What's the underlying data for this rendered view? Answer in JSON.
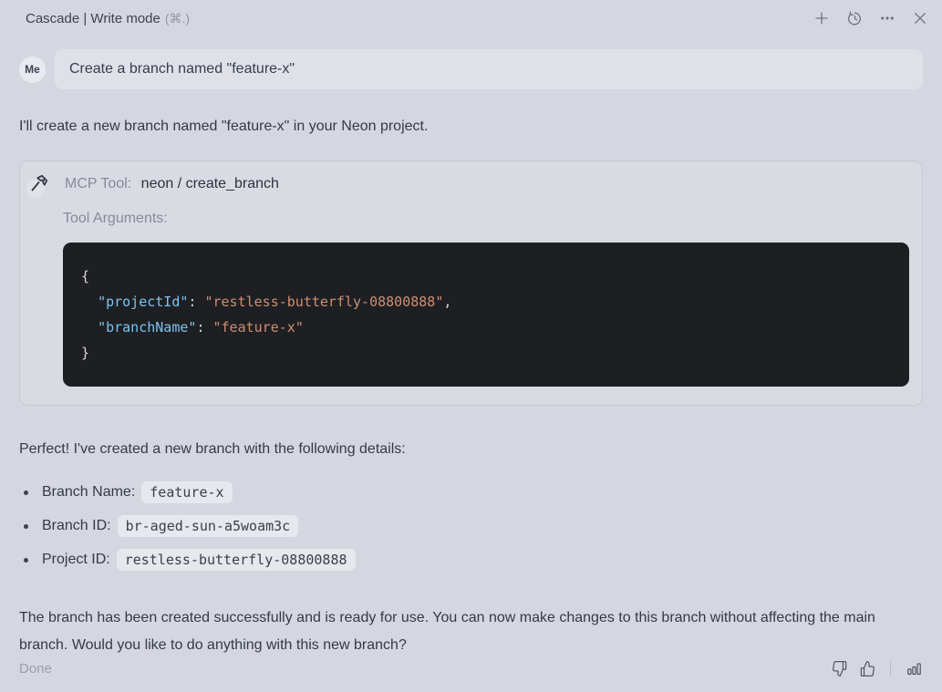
{
  "header": {
    "title": "Cascade | Write mode",
    "shortcut": "(⌘.)",
    "icons": [
      "plus-icon",
      "history-icon",
      "more-options-icon",
      "close-icon"
    ]
  },
  "user_message": {
    "avatar": "Me",
    "text": "Create a branch named \"feature-x\""
  },
  "assistant": {
    "intro": "I'll create a new branch named \"feature-x\" in your Neon project.",
    "tool_card": {
      "icon": "hammer-icon",
      "label": "MCP Tool:",
      "tool_name": "neon / create_branch",
      "args_label": "Tool Arguments:",
      "code": {
        "open_brace": "{",
        "line1": {
          "indent": "  ",
          "key": "\"projectId\"",
          "sep": ": ",
          "value": "\"restless-butterfly-08800888\"",
          "trail": ","
        },
        "line2": {
          "indent": "  ",
          "key": "\"branchName\"",
          "sep": ": ",
          "value": "\"feature-x\"",
          "trail": ""
        },
        "close_brace": "}"
      }
    },
    "result_intro": "Perfect! I've created a new branch with the following details:",
    "details": [
      {
        "label": "Branch Name:",
        "value": "feature-x"
      },
      {
        "label": "Branch ID:",
        "value": "br-aged-sun-a5woam3c"
      },
      {
        "label": "Project ID:",
        "value": "restless-butterfly-08800888"
      }
    ],
    "closing": "The branch has been created successfully and is ready for use. You can now make changes to this branch without affecting the main branch. Would you like to do anything with this new branch?"
  },
  "footer": {
    "status": "Done",
    "icons": [
      "thumbs-down-icon",
      "thumbs-up-icon",
      "bar-chart-icon"
    ]
  },
  "colors": {
    "page_bg": "#d5d7e0",
    "bubble_bg": "#dfe1e9",
    "code_bg": "#1e1f23",
    "code_key": "#7ec3ef",
    "code_string": "#cd8f72",
    "code_punct": "#d6d6d6",
    "inline_code_bg": "#e7e8ed",
    "card_border": "#c6c8d2"
  }
}
